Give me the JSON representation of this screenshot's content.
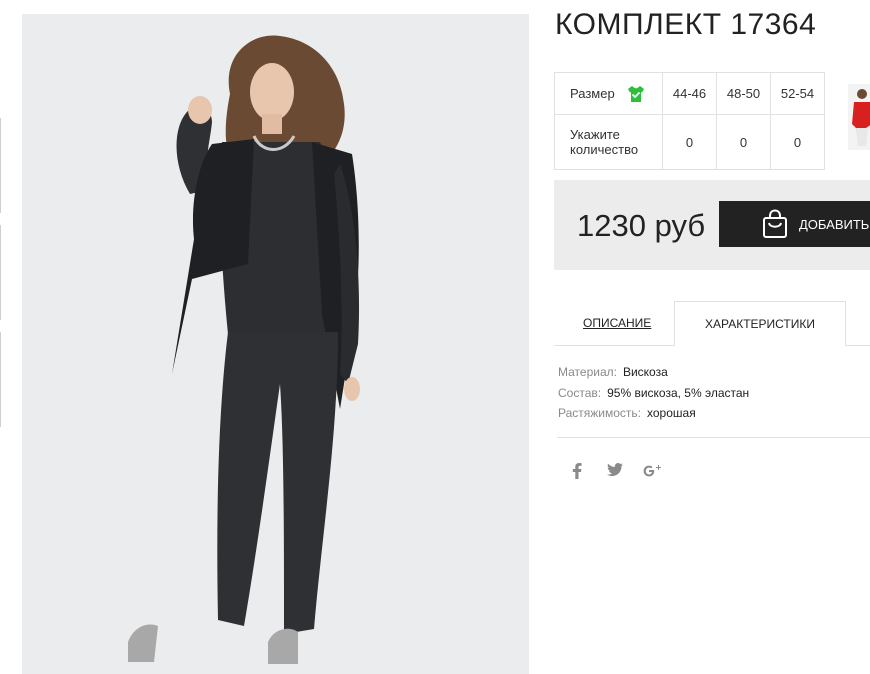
{
  "product": {
    "title": "КОМПЛЕКТ 17364",
    "image_alt": "model in dark grey trouser suit with drape cardigan"
  },
  "size_table": {
    "size_label": "Размер",
    "quantity_label": "Укажите количество",
    "sizes": [
      "44-46",
      "48-50",
      "52-54"
    ],
    "quantities": [
      "0",
      "0",
      "0"
    ],
    "size_icon": "shirt-check-icon"
  },
  "price": {
    "value": "1230 руб",
    "add_button_label": "ДОБАВИТЬ",
    "button_icon": "shopping-bag-icon"
  },
  "tabs": {
    "description": "ОПИСАНИЕ",
    "characteristics": "ХАРАКТЕРИСТИКИ",
    "active": "characteristics"
  },
  "specs": [
    {
      "key": "Материал:",
      "value": "Вискоза"
    },
    {
      "key": "Состав:",
      "value": "95% вискоза, 5% эластан"
    },
    {
      "key": "Растяжимость:",
      "value": "хорошая"
    }
  ],
  "social": [
    "facebook-icon",
    "twitter-icon",
    "google-plus-icon"
  ],
  "colors": {
    "accent_green": "#2bbf3c",
    "button_bg": "#222222",
    "price_box_bg": "#ececec"
  }
}
